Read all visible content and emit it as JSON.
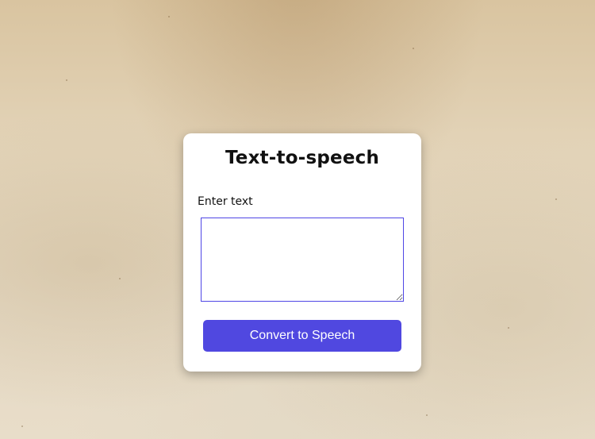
{
  "card": {
    "title": "Text-to-speech",
    "input_label": "Enter text",
    "textarea_value": "",
    "button_label": "Convert to Speech"
  },
  "colors": {
    "accent": "#5048e0",
    "textarea_border": "#4f46e5",
    "card_background": "#ffffff",
    "page_background": "#e4d8c0"
  }
}
